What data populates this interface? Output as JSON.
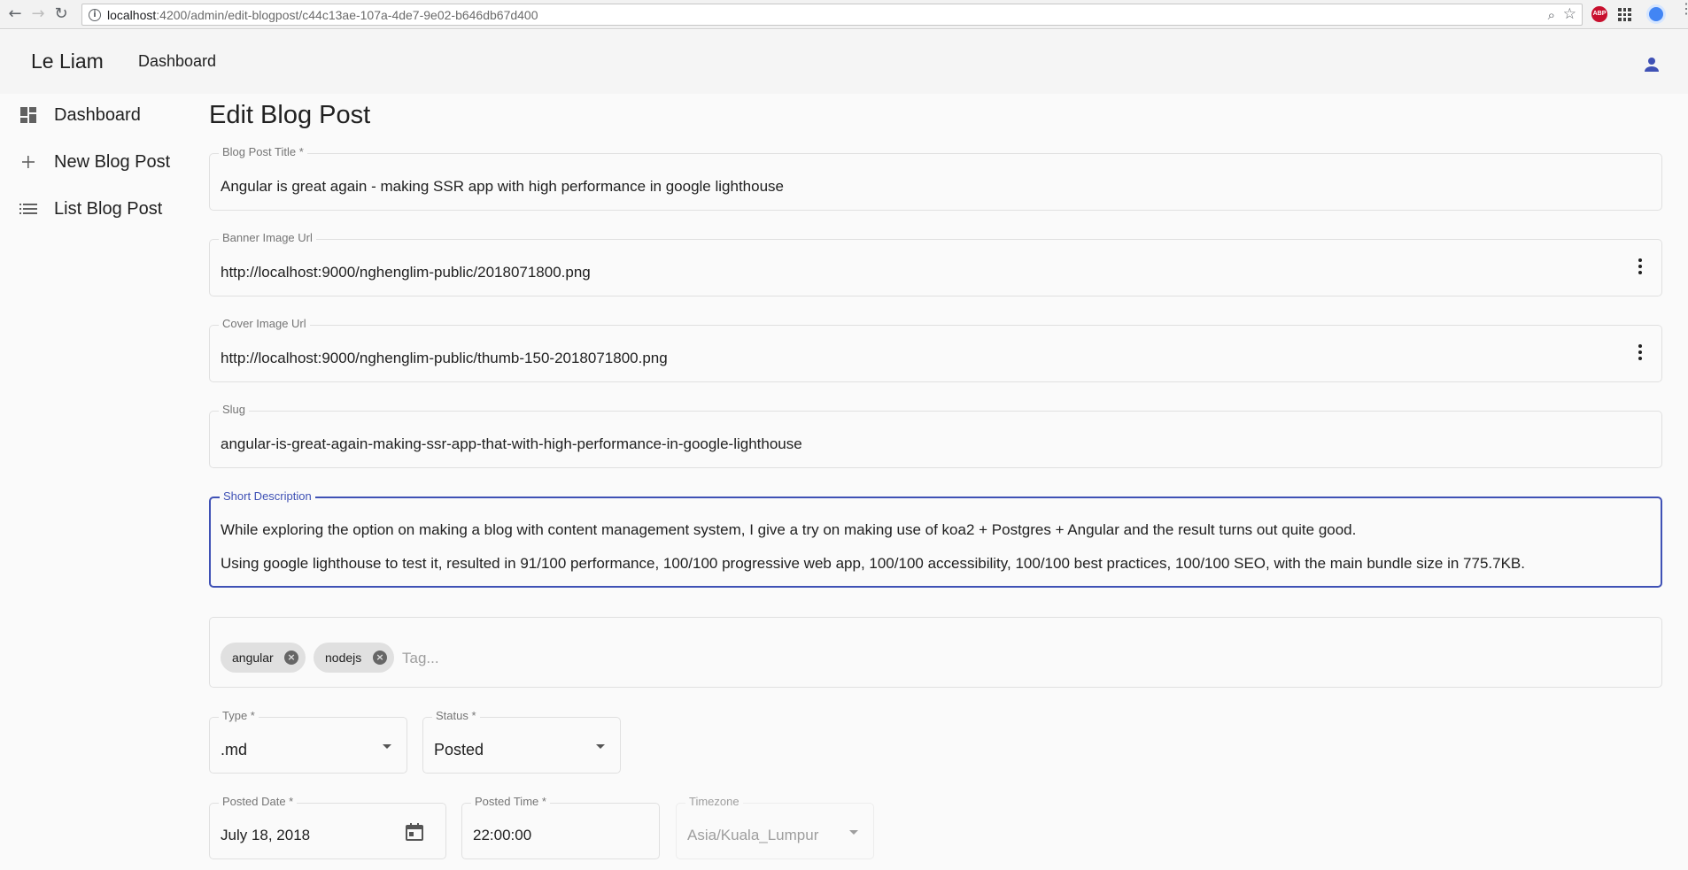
{
  "browser": {
    "url_host": "localhost",
    "url_rest": ":4200/admin/edit-blogpost/c44c13ae-107a-4de7-9e02-b646db67d400",
    "extension_abp": "ABP"
  },
  "toolbar": {
    "brand": "Le Liam",
    "dashboard_link": "Dashboard"
  },
  "sidebar": {
    "items": [
      {
        "label": "Dashboard",
        "icon": "dashboard-icon"
      },
      {
        "label": "New Blog Post",
        "icon": "add-icon"
      },
      {
        "label": "List Blog Post",
        "icon": "list-icon"
      }
    ]
  },
  "form": {
    "page_title": "Edit Blog Post",
    "title": {
      "label": "Blog Post Title *",
      "value": "Angular is great again - making SSR app with high performance in google lighthouse"
    },
    "banner": {
      "label": "Banner Image Url",
      "value": "http://localhost:9000/nghenglim-public/2018071800.png"
    },
    "cover": {
      "label": "Cover Image Url",
      "value": "http://localhost:9000/nghenglim-public/thumb-150-2018071800.png"
    },
    "slug": {
      "label": "Slug",
      "value": "angular-is-great-again-making-ssr-app-that-with-high-performance-in-google-lighthouse"
    },
    "short_description": {
      "label": "Short Description",
      "line1": "While exploring the option on making a blog with content management system, I give a try on making use of koa2 + Postgres + Angular and the result turns out quite good.",
      "line2": "Using google lighthouse to test it, resulted in 91/100 performance, 100/100 progressive web app, 100/100 accessibility, 100/100 best practices, 100/100 SEO, with the main bundle size in 775.7KB."
    },
    "tags": {
      "chips": [
        "angular",
        "nodejs"
      ],
      "placeholder": "Tag..."
    },
    "type": {
      "label": "Type *",
      "value": ".md"
    },
    "status": {
      "label": "Status *",
      "value": "Posted"
    },
    "posted_date": {
      "label": "Posted Date *",
      "value": "July 18, 2018"
    },
    "posted_time": {
      "label": "Posted Time *",
      "value": "22:00:00"
    },
    "timezone": {
      "label": "Timezone",
      "value": "Asia/Kuala_Lumpur"
    }
  },
  "colors": {
    "accent": "#3f51b5",
    "border": "#e0e0e0",
    "chip_bg": "#e0e0e0"
  }
}
